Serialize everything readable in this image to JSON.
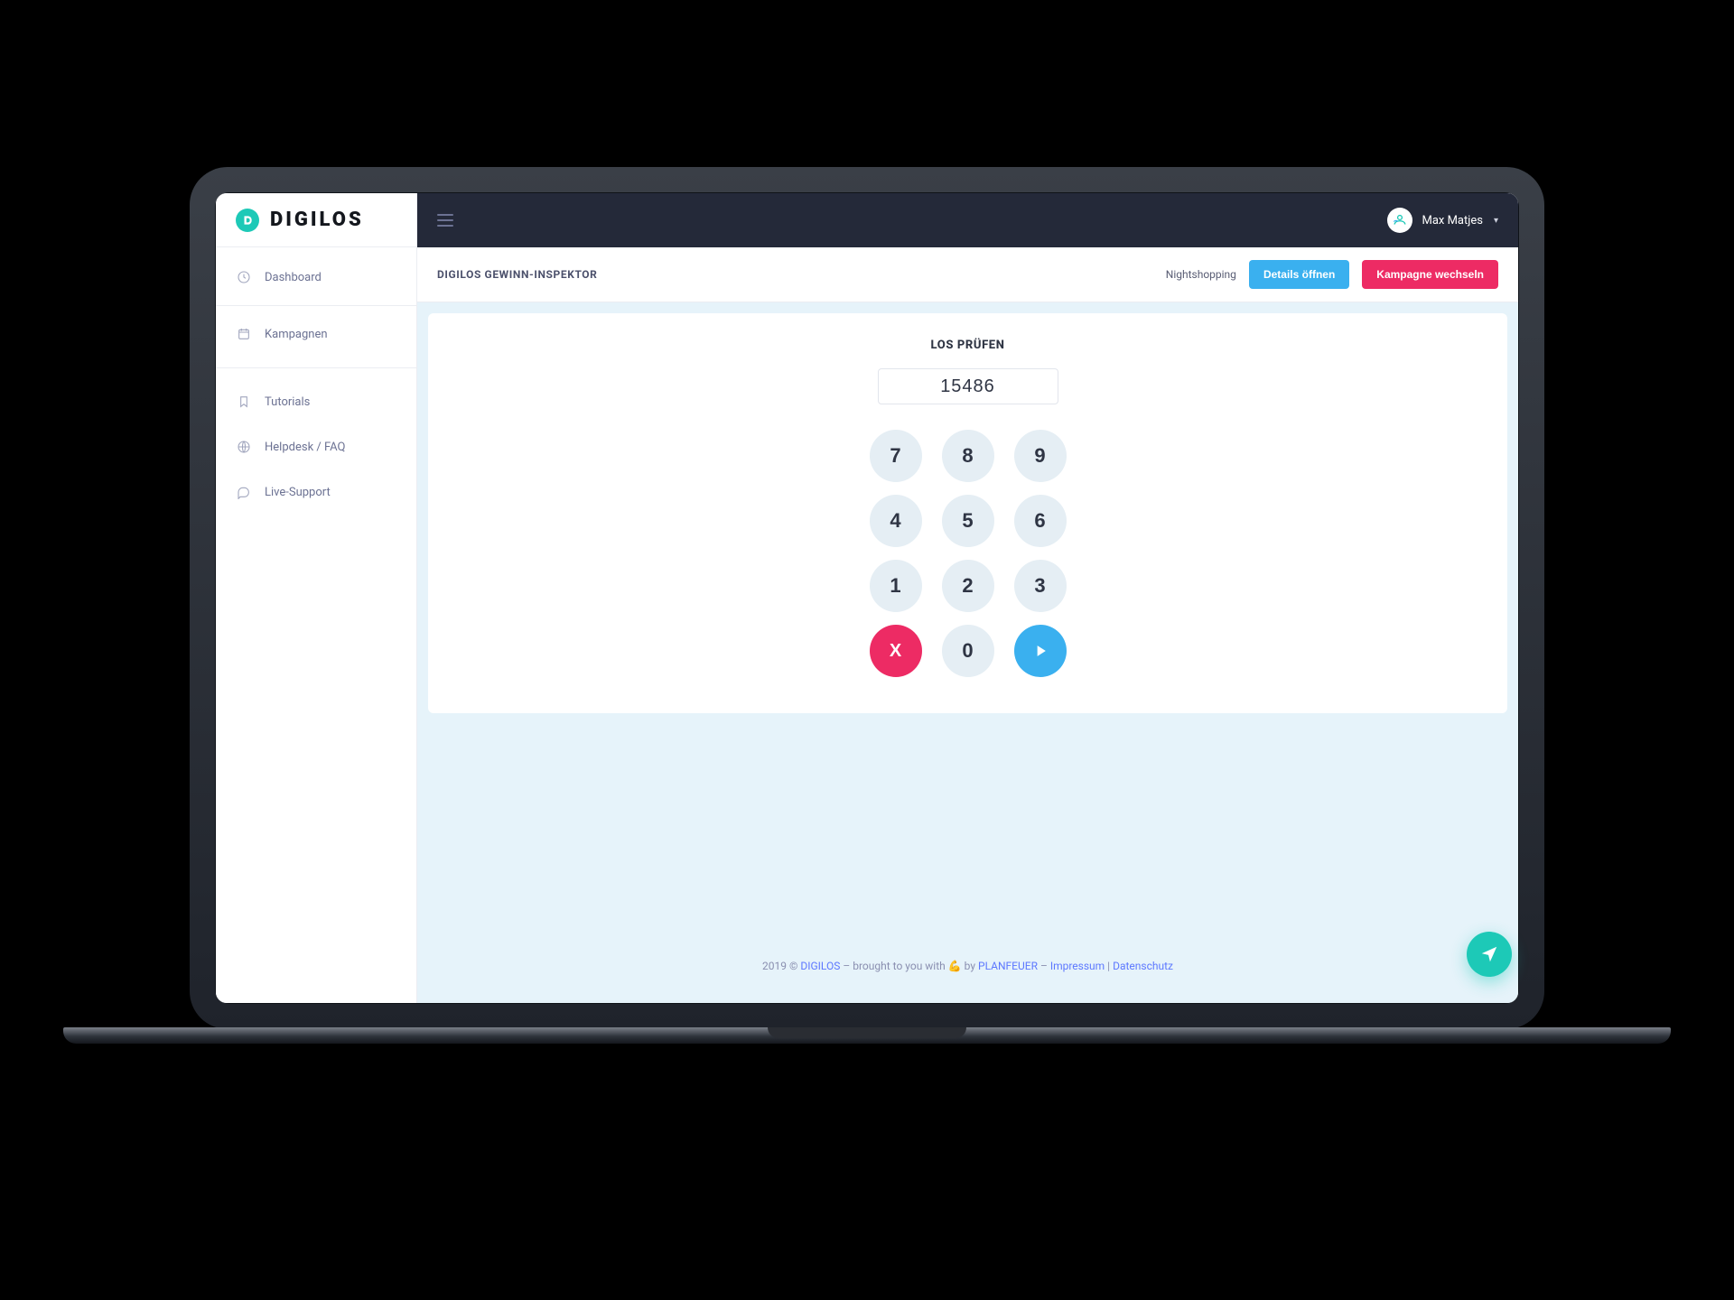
{
  "brand": {
    "name": "DIGILOS",
    "badge_letter": "D"
  },
  "sidebar": {
    "items": [
      {
        "label": "Dashboard"
      },
      {
        "label": "Kampagnen"
      },
      {
        "label": "Tutorials"
      },
      {
        "label": "Helpdesk / FAQ"
      },
      {
        "label": "Live-Support"
      }
    ]
  },
  "topbar": {
    "user_name": "Max Matjes"
  },
  "subheader": {
    "title": "DIGILOS GEWINN-INSPEKTOR",
    "campaign": "Nightshopping",
    "details_button": "Details öffnen",
    "switch_button": "Kampagne wechseln"
  },
  "card": {
    "title": "LOS PRÜFEN",
    "display_value": "15486",
    "keys": {
      "r1": [
        "7",
        "8",
        "9"
      ],
      "r2": [
        "4",
        "5",
        "6"
      ],
      "r3": [
        "1",
        "2",
        "3"
      ],
      "clear": "X",
      "zero": "0"
    }
  },
  "footer": {
    "year": "2019 © ",
    "brand": "DIGILOS",
    "mid": " – brought to you with ",
    "emoji": "💪",
    "by": "  by ",
    "author": "PLANFEUER",
    "dash": " – ",
    "impressum": "Impressum",
    "pipe": " | ",
    "datenschutz": "Datenschutz"
  }
}
